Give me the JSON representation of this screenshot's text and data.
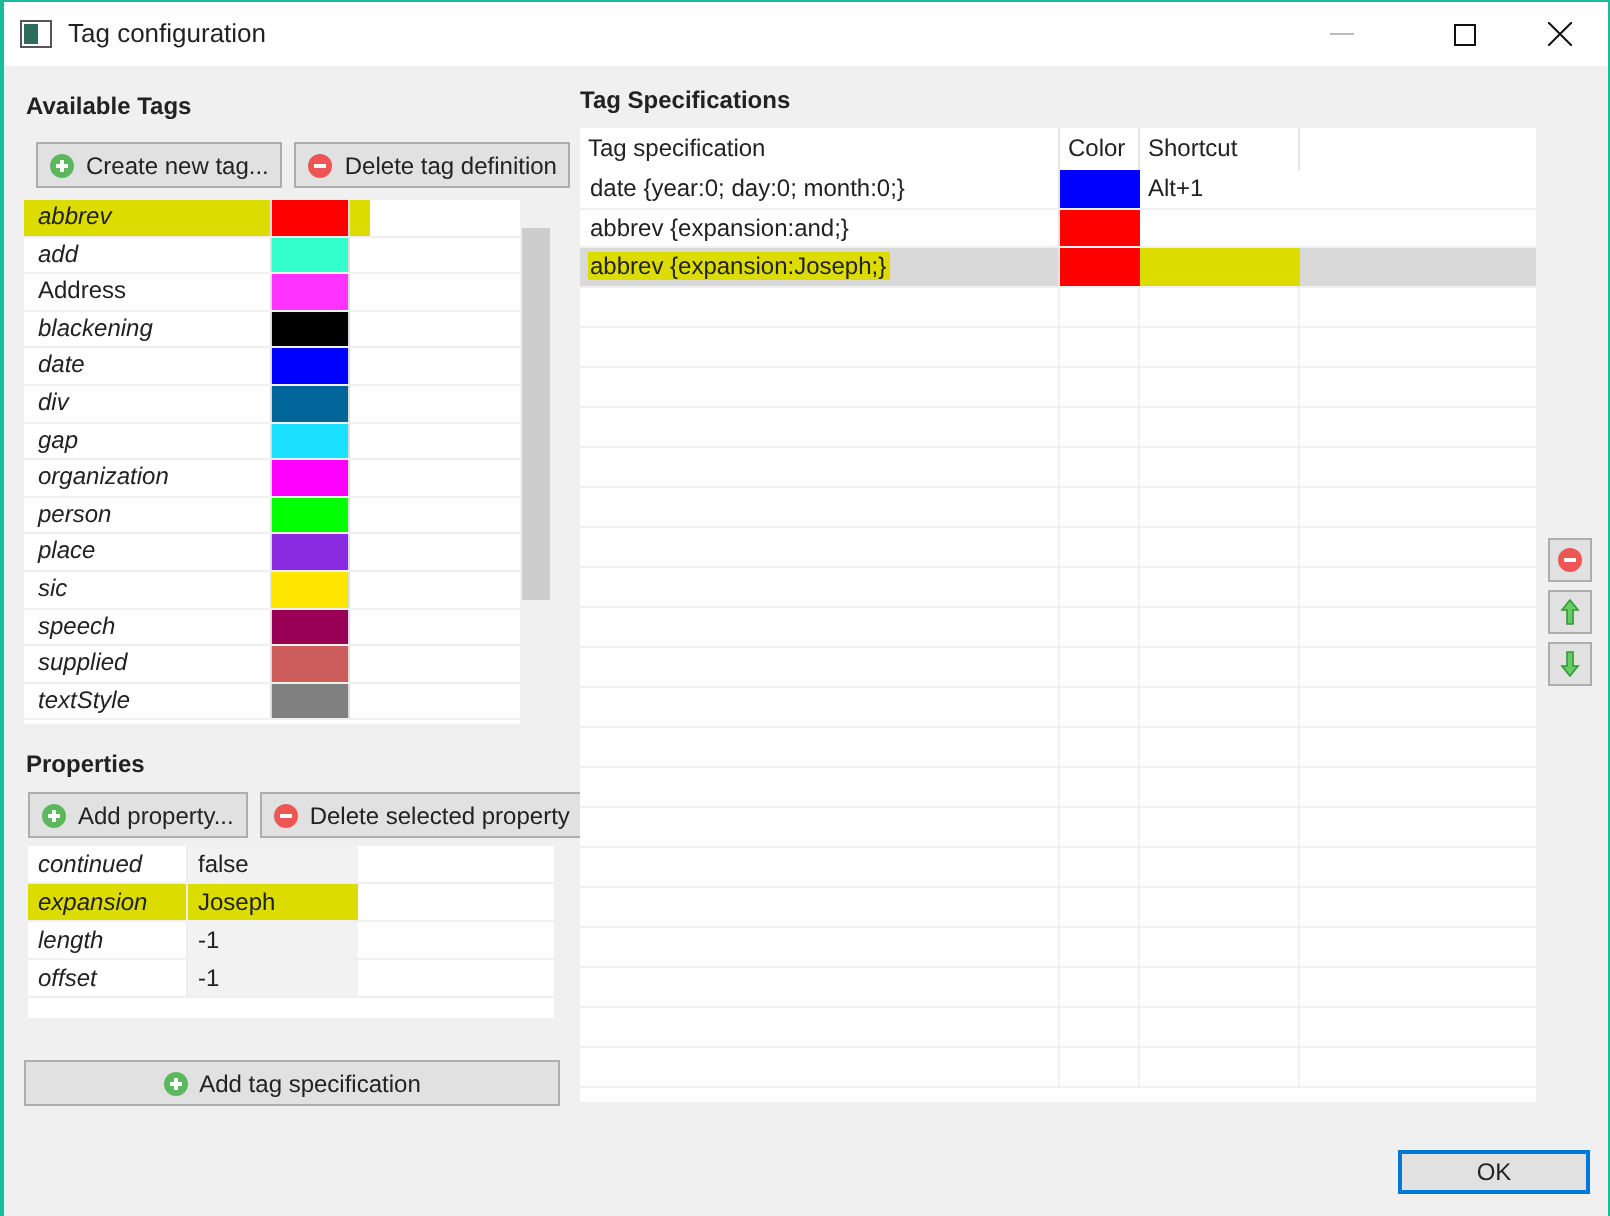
{
  "window": {
    "title": "Tag configuration"
  },
  "available_tags": {
    "title": "Available Tags",
    "buttons": [
      {
        "label": "Create new tag...",
        "kind": "add"
      },
      {
        "label": "Delete tag definition",
        "kind": "remove"
      }
    ],
    "tags": [
      {
        "name": "abbrev",
        "color": "#ff0000",
        "italic": true,
        "highlighted": true
      },
      {
        "name": "add",
        "color": "#33ffcc",
        "italic": true,
        "highlighted": false
      },
      {
        "name": "Address",
        "color": "#ff33ff",
        "italic": false,
        "highlighted": false
      },
      {
        "name": "blackening",
        "color": "#000000",
        "italic": true,
        "highlighted": false
      },
      {
        "name": "date",
        "color": "#0000ff",
        "italic": true,
        "highlighted": false
      },
      {
        "name": "div",
        "color": "#006699",
        "italic": true,
        "highlighted": false
      },
      {
        "name": "gap",
        "color": "#1ae1ff",
        "italic": true,
        "highlighted": false
      },
      {
        "name": "organization",
        "color": "#ff00ff",
        "italic": true,
        "highlighted": false
      },
      {
        "name": "person",
        "color": "#00ff00",
        "italic": true,
        "highlighted": false
      },
      {
        "name": "place",
        "color": "#8a2be2",
        "italic": true,
        "highlighted": false
      },
      {
        "name": "sic",
        "color": "#ffe600",
        "italic": true,
        "highlighted": false
      },
      {
        "name": "speech",
        "color": "#990055",
        "italic": true,
        "highlighted": false
      },
      {
        "name": "supplied",
        "color": "#cd5c5c",
        "italic": true,
        "highlighted": false
      },
      {
        "name": "textStyle",
        "color": "#808080",
        "italic": true,
        "highlighted": false
      }
    ]
  },
  "properties": {
    "title": "Properties",
    "buttons": [
      {
        "label": "Add property...",
        "kind": "add"
      },
      {
        "label": "Delete selected property",
        "kind": "remove"
      }
    ],
    "rows": [
      {
        "name": "continued",
        "value": "false",
        "highlighted": false
      },
      {
        "name": "expansion",
        "value": "Joseph",
        "highlighted": true
      },
      {
        "name": "length",
        "value": "-1",
        "highlighted": false
      },
      {
        "name": "offset",
        "value": "-1",
        "highlighted": false
      }
    ]
  },
  "add_spec_button": {
    "label": "Add tag specification",
    "kind": "add"
  },
  "tag_specifications": {
    "title": "Tag Specifications",
    "columns": [
      "Tag specification",
      "Color",
      "Shortcut"
    ],
    "rows": [
      {
        "spec": "date {year:0; day:0; month:0;}",
        "color": "#0000ff",
        "shortcut": "Alt+1",
        "selected": false,
        "highlighted": false
      },
      {
        "spec": "abbrev {expansion:and;}",
        "color": "#ff0000",
        "selected": false,
        "highlighted": false
      },
      {
        "spec": "abbrev {expansion:Joseph;}",
        "color": "#ff0000",
        "selected": true,
        "highlighted": true
      }
    ]
  },
  "side_buttons": [
    {
      "kind": "remove"
    },
    {
      "kind": "up"
    },
    {
      "kind": "down"
    }
  ],
  "ok_button": {
    "label": "OK"
  }
}
